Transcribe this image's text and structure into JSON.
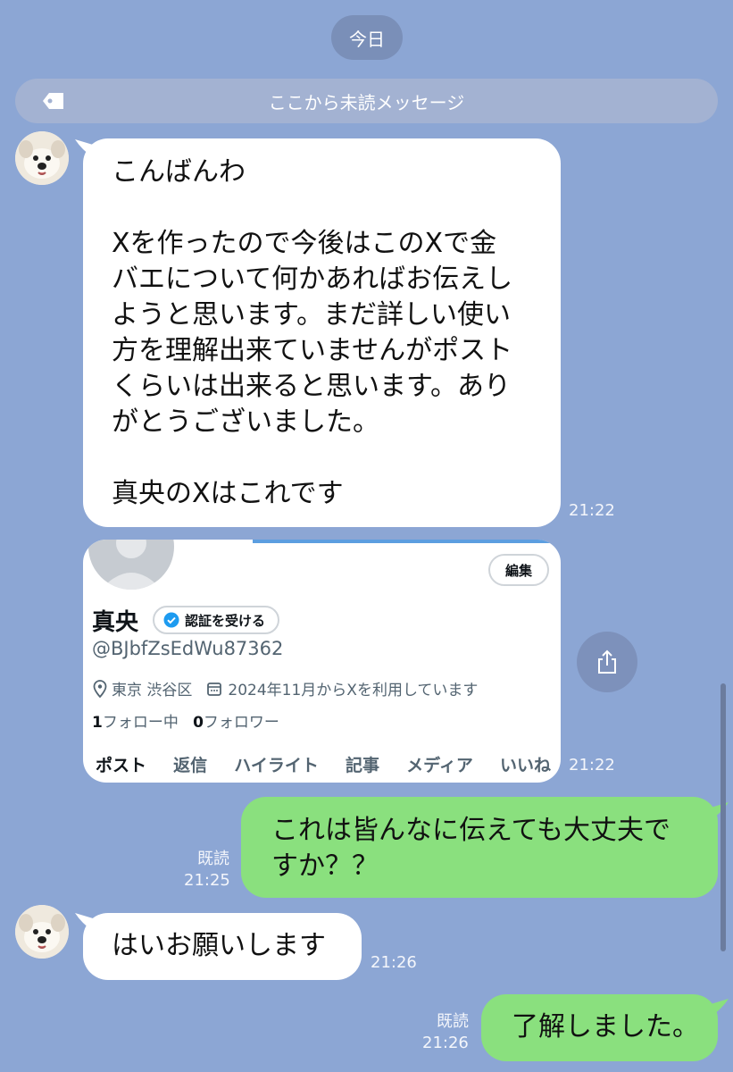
{
  "date_separator": "今日",
  "unread_marker": "ここから未読メッセージ",
  "messages": [
    {
      "text": "こんばんわ\n\nXを作ったので今後はこのXで金\nバエについて何かあればお伝えし\nようと思います。まだ詳しい使い\n方を理解出来ていませんがポスト\nくらいは出来ると思います。あり\nがとうございました。\n\n真央のXはこれです",
      "time": "21:22"
    },
    {
      "time": "21:22"
    },
    {
      "text": "これは皆んなに伝えても大丈夫で\nすか？？",
      "read": "既読",
      "time": "21:25"
    },
    {
      "text": "はいお願いします",
      "time": "21:26"
    },
    {
      "text": "了解しました。",
      "read": "既読",
      "time": "21:26"
    }
  ],
  "profile_card": {
    "edit_label": "編集",
    "name": "真央",
    "verify_label": "認証を受ける",
    "handle": "@BJbfZsEdWu87362",
    "location": "東京 渋谷区",
    "joined": "2024年11月からXを利用しています",
    "following_count": "1",
    "following_label": "フォロー中",
    "followers_count": "0",
    "followers_label": "フォロワー",
    "tabs": [
      "ポスト",
      "返信",
      "ハイライト",
      "記事",
      "メディア",
      "いいね"
    ]
  },
  "colors": {
    "background": "#8ca6d4",
    "outgoing_bubble": "#8ae07e",
    "incoming_bubble": "#ffffff"
  },
  "icons": [
    "tag-icon",
    "share-icon",
    "verified-badge-icon",
    "location-pin-icon",
    "calendar-icon"
  ]
}
